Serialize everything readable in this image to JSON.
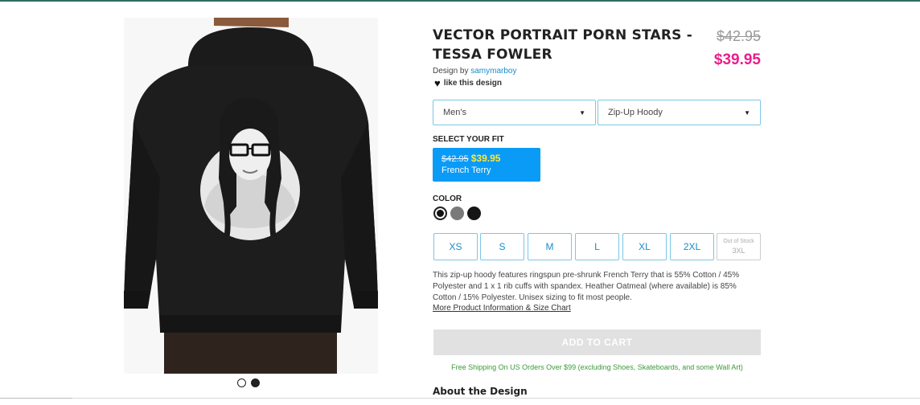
{
  "product": {
    "title": "VECTOR PORTRAIT PORN STARS - TESSA FOWLER",
    "price_old": "$42.95",
    "price_new": "$39.95",
    "design_by_prefix": "Design by",
    "designer": "samymarboy",
    "like_label": "like this design"
  },
  "selectors": {
    "category": "Men's",
    "style": "Zip-Up Hoody"
  },
  "fit": {
    "label": "SELECT YOUR FIT",
    "price_old": "$42.95",
    "price_new": "$39.95",
    "name": "French Terry"
  },
  "color": {
    "label": "COLOR",
    "swatches": [
      {
        "name": "black",
        "hex": "#111111",
        "selected": true
      },
      {
        "name": "heather-gray",
        "hex": "#7a7a7a",
        "selected": false
      },
      {
        "name": "black-2",
        "hex": "#151515",
        "selected": false
      }
    ]
  },
  "sizes": [
    "XS",
    "S",
    "M",
    "L",
    "XL",
    "2XL"
  ],
  "out_of_stock": {
    "label": "Out of Stock",
    "size": "3XL"
  },
  "description": "This zip-up hoody features ringspun pre-shrunk French Terry that is 55% Cotton / 45% Polyester and 1 x 1 rib cuffs with spandex. Heather Oatmeal (where available) is 85% Cotton / 15% Polyester. Unisex sizing to fit most people.",
  "more_info": "More Product Information & Size Chart",
  "add_to_cart": "ADD TO CART",
  "shipping": "Free Shipping On US Orders Over $99 (excluding Shoes, Skateboards, and some Wall Art)",
  "about": "About the Design",
  "gallery": {
    "slides": 2,
    "active": 2
  },
  "colors": {
    "accent": "#0a9bf7",
    "sale_price": "#e91e8c",
    "link": "#1a8bc9",
    "shipping_text": "#3a9a3a"
  }
}
